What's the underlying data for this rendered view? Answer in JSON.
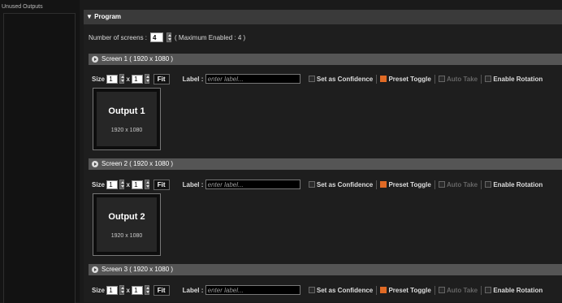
{
  "left_panel": {
    "title": "Unused Outputs"
  },
  "program": {
    "header": "▼ Program",
    "num_screens_label": "Number of screens :",
    "num_screens_value": "4",
    "max_enabled": "( Maximum Enabled : 4 )"
  },
  "controls": {
    "size_label": "Size",
    "x": "x",
    "fit": "Fit",
    "label_label": "Label :",
    "label_placeholder": "enter label...",
    "set_confidence": "Set as Confidence",
    "preset_toggle": "Preset Toggle",
    "auto_take": "Auto Take",
    "enable_rotation": "Enable Rotation"
  },
  "screens": [
    {
      "title": "Screen 1  ( 1920 x 1080 )",
      "w": "1",
      "h": "1",
      "output": "Output 1",
      "res": "1920 x 1080"
    },
    {
      "title": "Screen 2  ( 1920 x 1080 )",
      "w": "1",
      "h": "1",
      "output": "Output 2",
      "res": "1920 x 1080"
    },
    {
      "title": "Screen 3  ( 1920 x 1080 )",
      "w": "1",
      "h": "1"
    }
  ],
  "colors": {
    "accent": "#e06a25",
    "screen_header": "#555555",
    "program_header": "#3a3a3a"
  }
}
